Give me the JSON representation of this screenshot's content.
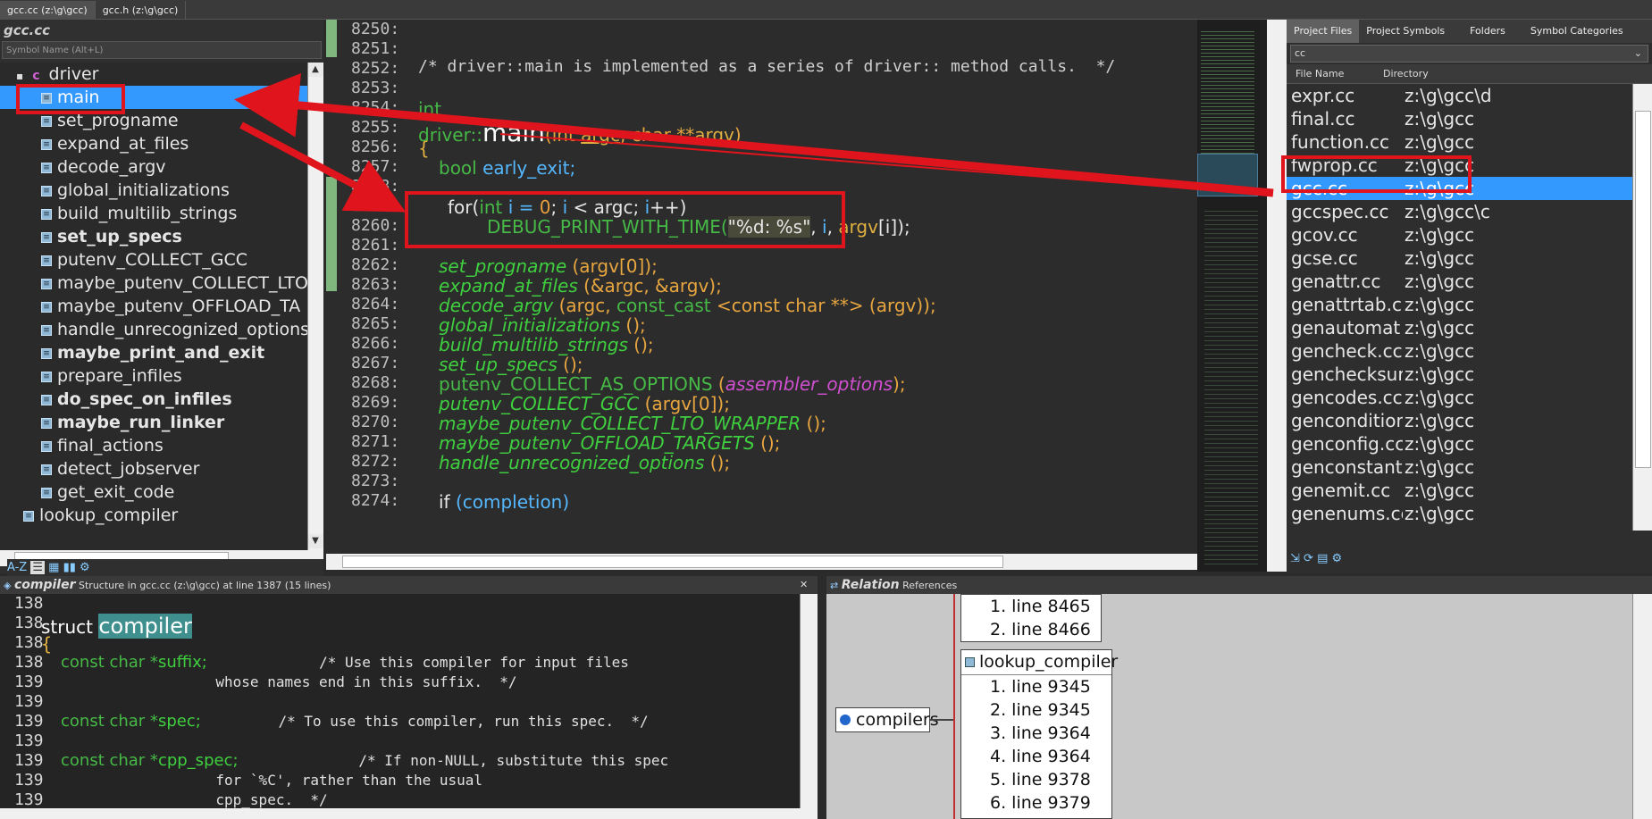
{
  "tabs": [
    "gcc.cc (z:\\g\\gcc)",
    "gcc.h (z:\\g\\gcc)"
  ],
  "symbols": {
    "file_title": "gcc.cc",
    "search_placeholder": "Symbol Name (Alt+L)",
    "class_name": "driver",
    "items": [
      {
        "label": "main",
        "selected": true,
        "bold": false
      },
      {
        "label": "set_progname",
        "bold": false
      },
      {
        "label": "expand_at_files",
        "bold": false
      },
      {
        "label": "decode_argv",
        "bold": false
      },
      {
        "label": "global_initializations",
        "bold": false
      },
      {
        "label": "build_multilib_strings",
        "bold": false
      },
      {
        "label": "set_up_specs",
        "bold": true
      },
      {
        "label": "putenv_COLLECT_GCC",
        "bold": false
      },
      {
        "label": "maybe_putenv_COLLECT_LTO",
        "bold": false
      },
      {
        "label": "maybe_putenv_OFFLOAD_TA",
        "bold": false
      },
      {
        "label": "handle_unrecognized_options",
        "bold": false
      },
      {
        "label": "maybe_print_and_exit",
        "bold": true
      },
      {
        "label": "prepare_infiles",
        "bold": false
      },
      {
        "label": "do_spec_on_infiles",
        "bold": true
      },
      {
        "label": "maybe_run_linker",
        "bold": true
      },
      {
        "label": "final_actions",
        "bold": false
      },
      {
        "label": "detect_jobserver",
        "bold": false
      },
      {
        "label": "get_exit_code",
        "bold": false
      }
    ],
    "lookup": "lookup_compiler"
  },
  "editor": {
    "line_numbers": [
      "8250:",
      "8251:",
      "8252:",
      "8253:",
      "8254:",
      "8255:",
      "8256:",
      "8257:",
      "8258:",
      "8259:",
      "8260:",
      "8261:",
      "8262:",
      "8263:",
      "8264:",
      "8265:",
      "8266:",
      "8267:",
      "8268:",
      "8269:",
      "8270:",
      "8271:",
      "8272:",
      "8273:",
      "8274:"
    ],
    "comment_line": "/* driver::main is implemented as a series of driver:: method calls.  */",
    "int_kw": "int",
    "sig_class": "driver::",
    "sig_main": "main",
    "sig_params_a": "(int ",
    "sig_argc": "argc",
    "sig_mid": ", char **",
    "sig_argv": "argv",
    "sig_close": ")",
    "brace_open": "{",
    "bool_kw": "bool",
    "early_exit": "early_exit;",
    "for_kw": "for(",
    "for_int": "int",
    "for_i": " i = ",
    "for_zero": "0",
    "for_rest1": "; ",
    "for_i2": "i",
    "for_rest2": " < argc; ",
    "for_i3": "i",
    "for_rest3": "++)",
    "debug_macro": "DEBUG_PRINT_WITH_TIME(",
    "debug_str": "\"%d: %s\"",
    "debug_c1": ", ",
    "debug_i": "i",
    "debug_c2": ", ",
    "debug_argv": "argv",
    "debug_idx": "[i]",
    "debug_end": ");",
    "call_set_progname": "set_progname",
    "call_set_progname_args": " (argv[0]);",
    "call_expand": "expand_at_files",
    "call_expand_args": " (&argc, &argv);",
    "call_decode": "decode_argv",
    "call_decode_a": " (argc, ",
    "call_decode_cast": "const_cast",
    "call_decode_b": " <const char **> ",
    "call_decode_c": "(argv));",
    "call_global": "global_initializations",
    "call_global_args": " ();",
    "call_build": "build_multilib_strings",
    "call_build_args": " ();",
    "call_setup": "set_up_specs",
    "call_setup_args": " ();",
    "call_putenv_as": "putenv_COLLECT_AS_OPTIONS",
    "call_putenv_as_a": " (",
    "call_putenv_as_arg": "assembler_options",
    "call_putenv_as_b": ");",
    "call_putenv_gcc": "putenv_COLLECT_GCC",
    "call_putenv_gcc_args": " (argv[0]);",
    "call_maybe_lto": "maybe_putenv_COLLECT_LTO_WRAPPER",
    "call_maybe_lto_args": " ();",
    "call_maybe_off": "maybe_putenv_OFFLOAD_TARGETS",
    "call_maybe_off_args": " ();",
    "call_handle": "handle_unrecognized_options",
    "call_handle_args": " ();",
    "if_kw": "if",
    "if_rest": " (completion)"
  },
  "project": {
    "tabs": [
      "Project Files",
      "Project Symbols",
      "Folders",
      "Symbol Categories"
    ],
    "filter_value": "cc",
    "col_file": "File Name",
    "col_dir": "Directory",
    "files": [
      {
        "name": "expr.cc",
        "dir": "z:\\g\\gcc\\d"
      },
      {
        "name": "final.cc",
        "dir": "z:\\g\\gcc"
      },
      {
        "name": "function.cc",
        "dir": "z:\\g\\gcc"
      },
      {
        "name": "fwprop.cc",
        "dir": "z:\\g\\gcc"
      },
      {
        "name": "gcc.cc",
        "dir": "z:\\g\\gcc",
        "selected": true
      },
      {
        "name": "gccspec.cc",
        "dir": "z:\\g\\gcc\\c"
      },
      {
        "name": "gcov.cc",
        "dir": "z:\\g\\gcc"
      },
      {
        "name": "gcse.cc",
        "dir": "z:\\g\\gcc"
      },
      {
        "name": "genattr.cc",
        "dir": "z:\\g\\gcc"
      },
      {
        "name": "genattrtab.c",
        "dir": "z:\\g\\gcc"
      },
      {
        "name": "genautomat",
        "dir": "z:\\g\\gcc"
      },
      {
        "name": "gencheck.cc",
        "dir": "z:\\g\\gcc"
      },
      {
        "name": "genchecksur",
        "dir": "z:\\g\\gcc"
      },
      {
        "name": "gencodes.cc",
        "dir": "z:\\g\\gcc"
      },
      {
        "name": "gencondition",
        "dir": "z:\\g\\gcc"
      },
      {
        "name": "genconfig.cc",
        "dir": "z:\\g\\gcc"
      },
      {
        "name": "genconstant",
        "dir": "z:\\g\\gcc"
      },
      {
        "name": "genemit.cc",
        "dir": "z:\\g\\gcc"
      },
      {
        "name": "genenums.cc",
        "dir": "z:\\g\\gcc"
      }
    ]
  },
  "context": {
    "title": "compiler",
    "subtitle": "Structure in gcc.cc (z:\\g\\gcc) at line 1387 (15 lines)",
    "lines": [
      {
        "no": "138",
        "text": ""
      },
      {
        "no": "138",
        "pre": "struct ",
        "hl": "compiler"
      },
      {
        "no": "138",
        "text": "{"
      },
      {
        "no": "138",
        "kw": "const char *",
        "id": "suffix;",
        "cmt": "             /* Use this compiler for input files"
      },
      {
        "no": "139",
        "cmt2": "                  whose names end in this suffix.  */"
      },
      {
        "no": "139",
        "text": ""
      },
      {
        "no": "139",
        "kw": "const char *",
        "id": "spec;",
        "cmt": "         /* To use this compiler, run this spec.  */"
      },
      {
        "no": "139",
        "text": ""
      },
      {
        "no": "139",
        "kw": "const char *",
        "id": "cpp_spec;",
        "cmt": "              /* If non-NULL, substitute this spec"
      },
      {
        "no": "139",
        "cmt2": "                  for `%C', rather than the usual"
      },
      {
        "no": "139",
        "cmt2": "                  cpp_spec.  */"
      }
    ]
  },
  "relation": {
    "title": "Relation",
    "subtitle": "References",
    "root": "compilers",
    "top_items": [
      "1. line 8465",
      "2. line 8466"
    ],
    "group_title": "lookup_compiler",
    "group_items": [
      "1. line 9345",
      "2. line 9345",
      "3. line 9364",
      "4. line 9364",
      "5. line 9378",
      "6. line 9379"
    ]
  }
}
